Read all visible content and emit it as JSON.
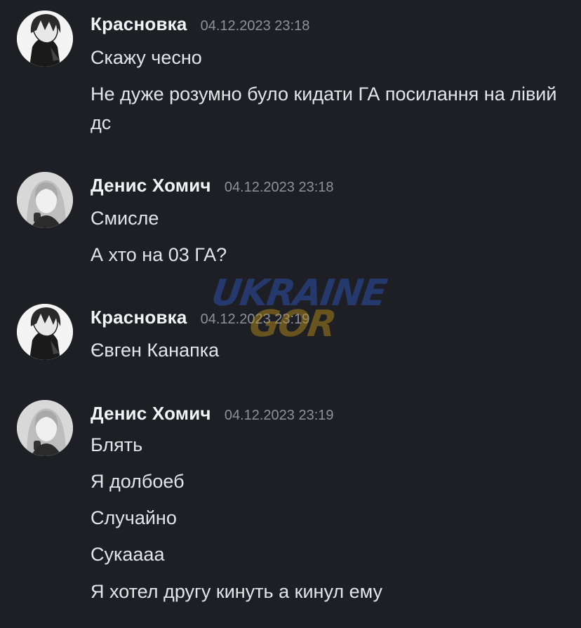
{
  "messages": [
    {
      "author": "Красновка",
      "timestamp": "04.12.2023 23:18",
      "avatar_icon": "anime-boy-avatar-icon",
      "lines": [
        "Скажу чесно",
        "Не дуже розумно було кидати ГА посилання на лівий дс"
      ]
    },
    {
      "author": "Денис Хомич",
      "timestamp": "04.12.2023 23:18",
      "avatar_icon": "girl-portrait-avatar-icon",
      "lines": [
        "Смисле",
        "А хто на 03 ГА?"
      ]
    },
    {
      "author": "Красновка",
      "timestamp": "04.12.2023 23:19",
      "avatar_icon": "anime-boy-avatar-icon",
      "lines": [
        "Євген Канапка"
      ]
    },
    {
      "author": "Денис Хомич",
      "timestamp": "04.12.2023 23:19",
      "avatar_icon": "girl-portrait-avatar-icon",
      "lines": [
        "Блять",
        "Я долбоеб",
        "Случайно",
        "Сукаааа",
        "Я хотел другу кинуть а кинул ему"
      ]
    }
  ],
  "watermark": {
    "top_text": "UKRAINE",
    "bottom_text": "GOR"
  },
  "colors": {
    "background": "#1e1f24",
    "text": "#e4e5e8",
    "timestamp": "#8e9199"
  }
}
